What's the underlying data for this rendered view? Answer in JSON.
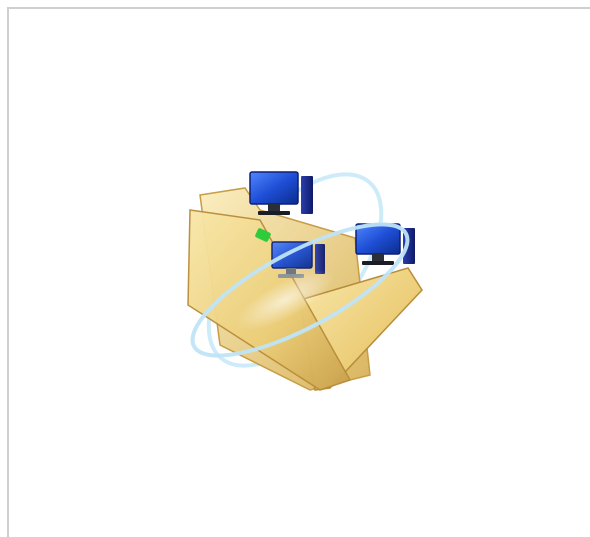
{
  "image": {
    "icon_name": "network-shared-folder-icon",
    "colors": {
      "background": "#ffffff",
      "frame_border": "#cfcfcf",
      "folder_light": "#f6e3a2",
      "folder_mid": "#e8c66a",
      "folder_dark": "#caa14a",
      "monitor_screen": "#1f4fd6",
      "monitor_body": "#1b2a8c",
      "orbit": "#bfe4f7",
      "tab_green": "#2ecc3a"
    }
  }
}
